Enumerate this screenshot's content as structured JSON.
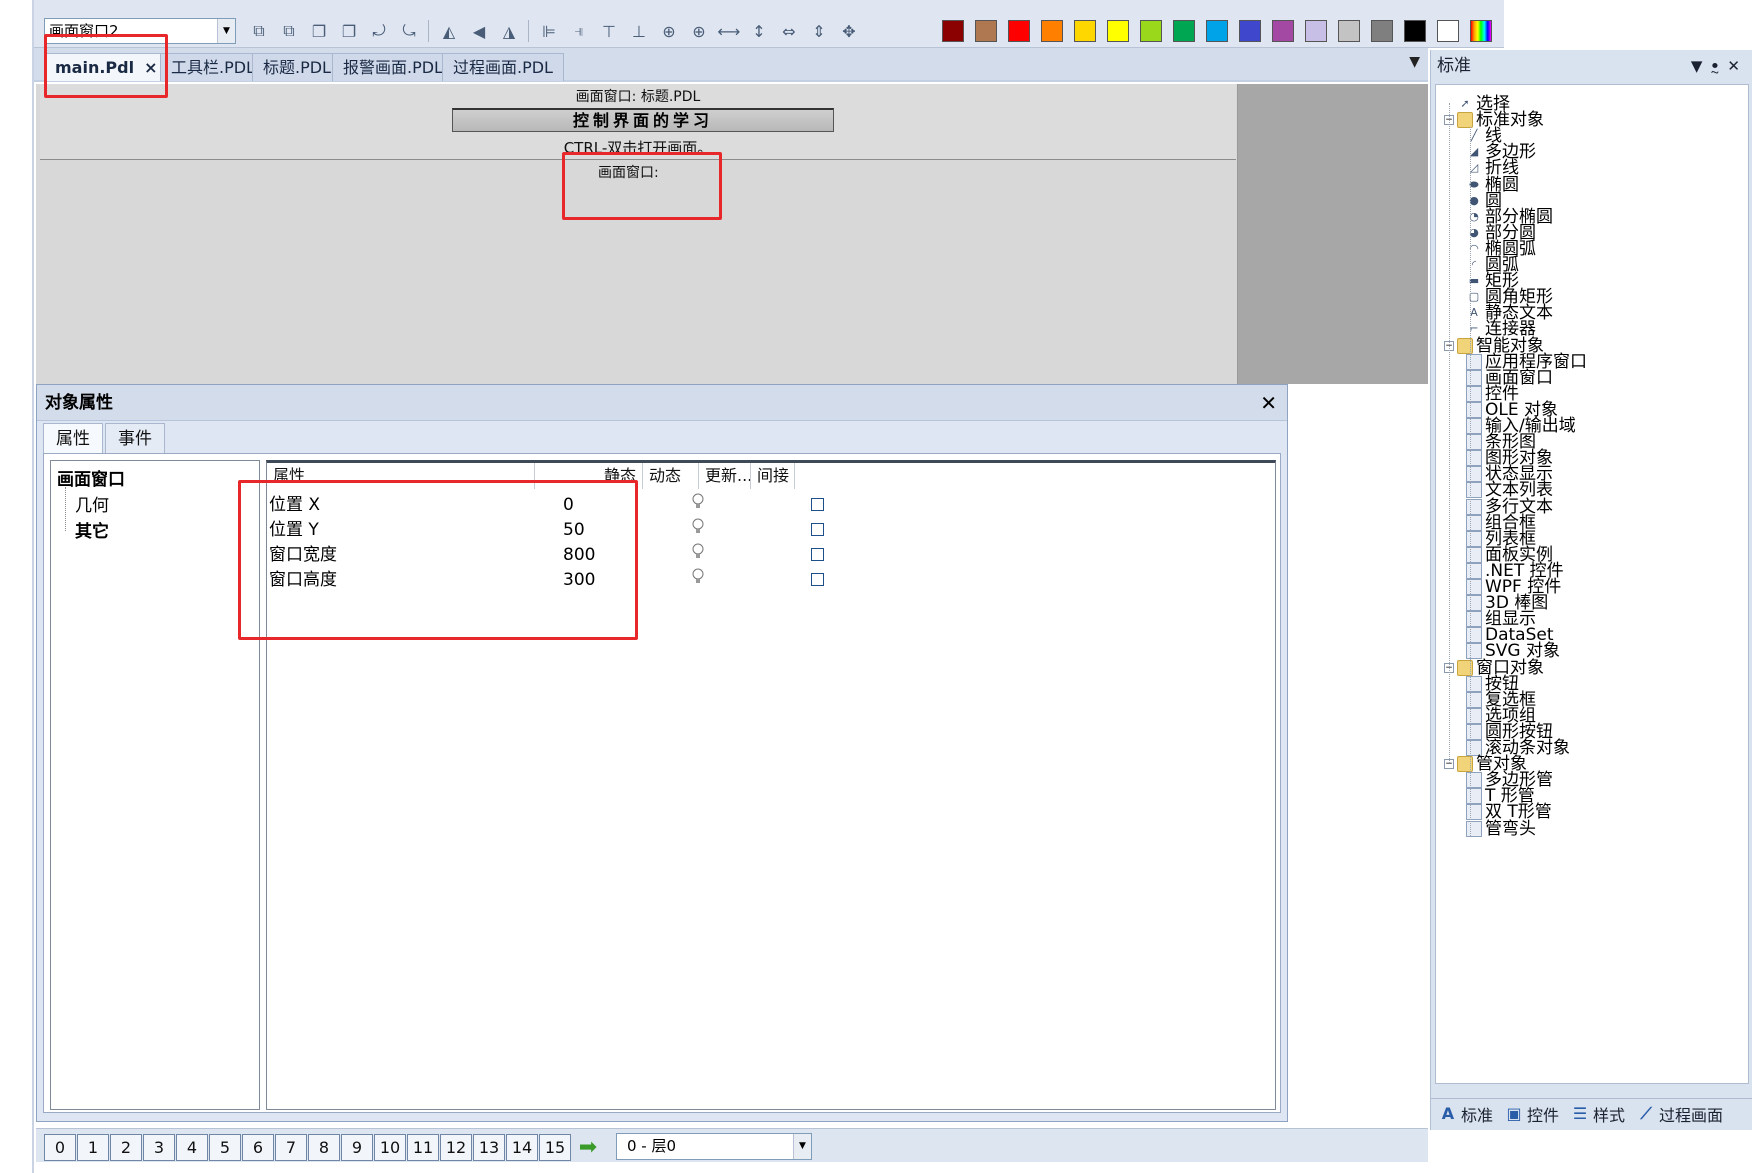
{
  "toolbar": {
    "object_combo_value": "画面窗口2",
    "colors": [
      "#8b0000",
      "#b07850",
      "#ff0000",
      "#ff7f00",
      "#ffd700",
      "#ffff00",
      "#99d81a",
      "#00a651",
      "#00a2e8",
      "#3f48cc",
      "#a349a4",
      "#c8bfe7",
      "#c3c3c3",
      "#7f7f7f",
      "#000000",
      "#ffffff"
    ]
  },
  "tabs": [
    {
      "label": "main.Pdl",
      "active": true,
      "close": "×"
    },
    {
      "label": "工具栏.PDL"
    },
    {
      "label": "标题.PDL"
    },
    {
      "label": "报警画面.PDL"
    },
    {
      "label": "过程画面.PDL"
    }
  ],
  "canvas": {
    "title_window_label": "画面窗口: 标题.PDL",
    "banner_text": "控制界面的学习",
    "hint_text": "CTRL-双击打开画面。",
    "screen_window_label": "画面窗口:"
  },
  "props": {
    "title": "对象属性",
    "tabs": [
      "属性",
      "事件"
    ],
    "tree": {
      "root": "画面窗口",
      "child1": "几何",
      "child2": "其它"
    },
    "columns": [
      "属性",
      "静态",
      "动态",
      "更新...",
      "间接"
    ],
    "rows": [
      {
        "name": "位置 X",
        "value": "0"
      },
      {
        "name": "位置 Y",
        "value": "50"
      },
      {
        "name": "窗口宽度",
        "value": "800"
      },
      {
        "name": "窗口高度",
        "value": "300"
      }
    ]
  },
  "right_panel": {
    "title": "标准",
    "header_icons": "▼ ꔸ ✕",
    "tree": [
      {
        "label": "选择",
        "level": 0,
        "icon": "cursor-icon"
      },
      {
        "label": "标准对象",
        "level": 0,
        "folder": true
      },
      {
        "label": "线",
        "level": 1,
        "icon": "line-icon"
      },
      {
        "label": "多边形",
        "level": 1,
        "icon": "polygon-icon"
      },
      {
        "label": "折线",
        "level": 1,
        "icon": "polyline-icon"
      },
      {
        "label": "椭圆",
        "level": 1,
        "icon": "ellipse-icon"
      },
      {
        "label": "圆",
        "level": 1,
        "icon": "circle-icon"
      },
      {
        "label": "部分椭圆",
        "level": 1,
        "icon": "ellipse-segment-icon"
      },
      {
        "label": "部分圆",
        "level": 1,
        "icon": "circle-segment-icon"
      },
      {
        "label": "椭圆弧",
        "level": 1,
        "icon": "ellipse-arc-icon"
      },
      {
        "label": "圆弧",
        "level": 1,
        "icon": "arc-icon"
      },
      {
        "label": "矩形",
        "level": 1,
        "icon": "rectangle-icon"
      },
      {
        "label": "圆角矩形",
        "level": 1,
        "icon": "rounded-rectangle-icon"
      },
      {
        "label": "静态文本",
        "level": 1,
        "icon": "static-text-icon"
      },
      {
        "label": "连接器",
        "level": 1,
        "icon": "connector-icon"
      },
      {
        "label": "智能对象",
        "level": 0,
        "folder": true
      },
      {
        "label": "应用程序窗口",
        "level": 1,
        "icon": "app-window-icon"
      },
      {
        "label": "画面窗口",
        "level": 1,
        "icon": "screen-window-icon"
      },
      {
        "label": "控件",
        "level": 1,
        "icon": "control-icon"
      },
      {
        "label": "OLE 对象",
        "level": 1,
        "icon": "ole-icon"
      },
      {
        "label": "输入/输出域",
        "level": 1,
        "icon": "io-field-icon"
      },
      {
        "label": "条形图",
        "level": 1,
        "icon": "bar-icon"
      },
      {
        "label": "图形对象",
        "level": 1,
        "icon": "graphic-object-icon"
      },
      {
        "label": "状态显示",
        "level": 1,
        "icon": "status-display-icon"
      },
      {
        "label": "文本列表",
        "level": 1,
        "icon": "text-list-icon"
      },
      {
        "label": "多行文本",
        "level": 1,
        "icon": "multiline-text-icon"
      },
      {
        "label": "组合框",
        "level": 1,
        "icon": "combobox-icon"
      },
      {
        "label": "列表框",
        "level": 1,
        "icon": "listbox-icon"
      },
      {
        "label": "面板实例",
        "level": 1,
        "icon": "faceplate-icon"
      },
      {
        "label": ".NET 控件",
        "level": 1,
        "icon": "dotnet-icon"
      },
      {
        "label": "WPF 控件",
        "level": 1,
        "icon": "wpf-icon"
      },
      {
        "label": "3D 棒图",
        "level": 1,
        "icon": "3d-bar-icon"
      },
      {
        "label": "组显示",
        "level": 1,
        "icon": "group-display-icon"
      },
      {
        "label": "DataSet",
        "level": 1,
        "icon": "dataset-icon"
      },
      {
        "label": "SVG 对象",
        "level": 1,
        "icon": "svg-icon"
      },
      {
        "label": "窗口对象",
        "level": 0,
        "folder": true
      },
      {
        "label": "按钮",
        "level": 1,
        "icon": "button-icon"
      },
      {
        "label": "复选框",
        "level": 1,
        "icon": "checkbox-icon"
      },
      {
        "label": "选项组",
        "level": 1,
        "icon": "option-group-icon"
      },
      {
        "label": "圆形按钮",
        "level": 1,
        "icon": "round-button-icon"
      },
      {
        "label": "滚动条对象",
        "level": 1,
        "icon": "scrollbar-icon"
      },
      {
        "label": "管对象",
        "level": 0,
        "folder": true
      },
      {
        "label": "多边形管",
        "level": 1,
        "icon": "polygon-tube-icon"
      },
      {
        "label": "T 形管",
        "level": 1,
        "icon": "t-piece-icon"
      },
      {
        "label": "双 T形管",
        "level": 1,
        "icon": "double-t-piece-icon"
      },
      {
        "label": "管弯头",
        "level": 1,
        "icon": "tube-bend-icon"
      }
    ],
    "bottom_tabs": [
      "标准",
      "控件",
      "样式",
      "过程画面"
    ]
  },
  "layers": {
    "buttons": [
      "0",
      "1",
      "2",
      "3",
      "4",
      "5",
      "6",
      "7",
      "8",
      "9",
      "10",
      "11",
      "12",
      "13",
      "14",
      "15"
    ],
    "combo_value": "0 - 层0"
  }
}
